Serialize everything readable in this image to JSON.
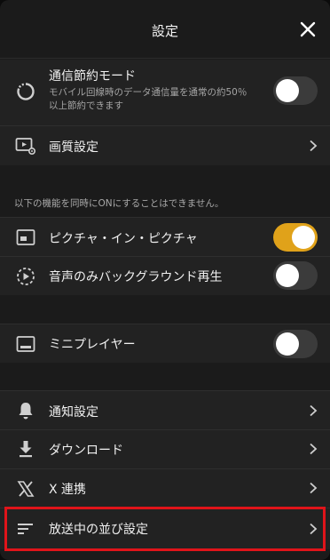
{
  "header": {
    "title": "設定",
    "close_icon": "close-icon"
  },
  "data_saver": {
    "label": "通信節約モード",
    "description": "モバイル回線時のデータ通信量を通常の約50％以上節約できます",
    "toggle_state": "off"
  },
  "quality": {
    "label": "画質設定"
  },
  "notice": "以下の機能を同時にONにすることはできません。",
  "pip": {
    "label": "ピクチャ・イン・ピクチャ",
    "toggle_state": "on"
  },
  "background_audio": {
    "label": "音声のみバックグラウンド再生",
    "toggle_state": "off"
  },
  "mini_player": {
    "label": "ミニプレイヤー",
    "toggle_state": "off"
  },
  "menu": {
    "notifications": "通知設定",
    "download": "ダウンロード",
    "x_link": "X 連携",
    "broadcast_sort": "放送中の並び設定"
  },
  "colors": {
    "accent": "#e0a21a",
    "highlight": "#e0141a",
    "background": "#1b1b1b",
    "row": "#222222"
  }
}
